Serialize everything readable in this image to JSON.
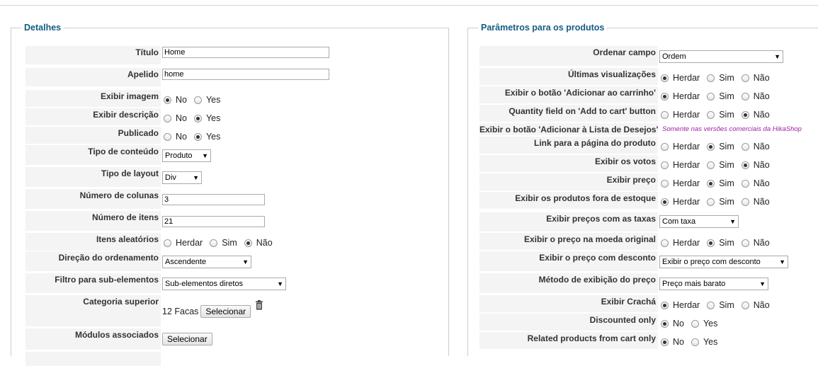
{
  "left": {
    "legend": "Detalhes",
    "title_label": "Título",
    "title_value": "Home",
    "alias_label": "Apelido",
    "alias_value": "home",
    "show_image_label": "Exibir imagem",
    "show_desc_label": "Exibir descrição",
    "published_label": "Publicado",
    "no": "No",
    "yes": "Yes",
    "content_type_label": "Tipo de conteúdo",
    "content_type_value": "Produto",
    "layout_type_label": "Tipo de layout",
    "layout_type_value": "Div",
    "columns_label": "Número de colunas",
    "columns_value": "3",
    "items_label": "Número de itens",
    "items_value": "21",
    "random_label": "Itens aleatórios",
    "inherit": "Herdar",
    "sim": "Sim",
    "nao": "Não",
    "order_dir_label": "Direção do ordenamento",
    "order_dir_value": "Ascendente",
    "filter_label": "Filtro para sub-elementos",
    "filter_value": "Sub-elementos diretos",
    "parent_cat_label": "Categoria superior",
    "parent_cat_value": "12 Facas",
    "select_label": "Selecionar",
    "modules_label": "Módulos associados"
  },
  "right": {
    "legend": "Parâmetros para os produtos",
    "order_field_label": "Ordenar campo",
    "order_field_value": "Ordem",
    "last_views_label": "Últimas visualizações",
    "add_cart_label": "Exibir o botão 'Adicionar ao carrinho'",
    "qty_label": "Quantity field on 'Add to cart' button",
    "wishlist_label": "Exibir o botão 'Adicionar à Lista de Desejos'",
    "wishlist_note": "Somente nas versões comerciais da HikaShop",
    "link_label": "Link para a página do produto",
    "votes_label": "Exibir os votos",
    "price_label": "Exibir preço",
    "out_stock_label": "Exibir os produtos fora de estoque",
    "taxes_label": "Exibir preços com as taxas",
    "taxes_value": "Com taxa",
    "currency_label": "Exibir o preço na moeda original",
    "discount_label": "Exibir o preço com desconto",
    "discount_value": "Exibir o preço com desconto",
    "price_method_label": "Método de exibição do preço",
    "price_method_value": "Preço mais barato",
    "badge_label": "Exibir Crachá",
    "discounted_label": "Discounted only",
    "related_label": "Related products from cart only",
    "inherit": "Herdar",
    "sim": "Sim",
    "nao": "Não",
    "no": "No",
    "yes": "Yes"
  }
}
